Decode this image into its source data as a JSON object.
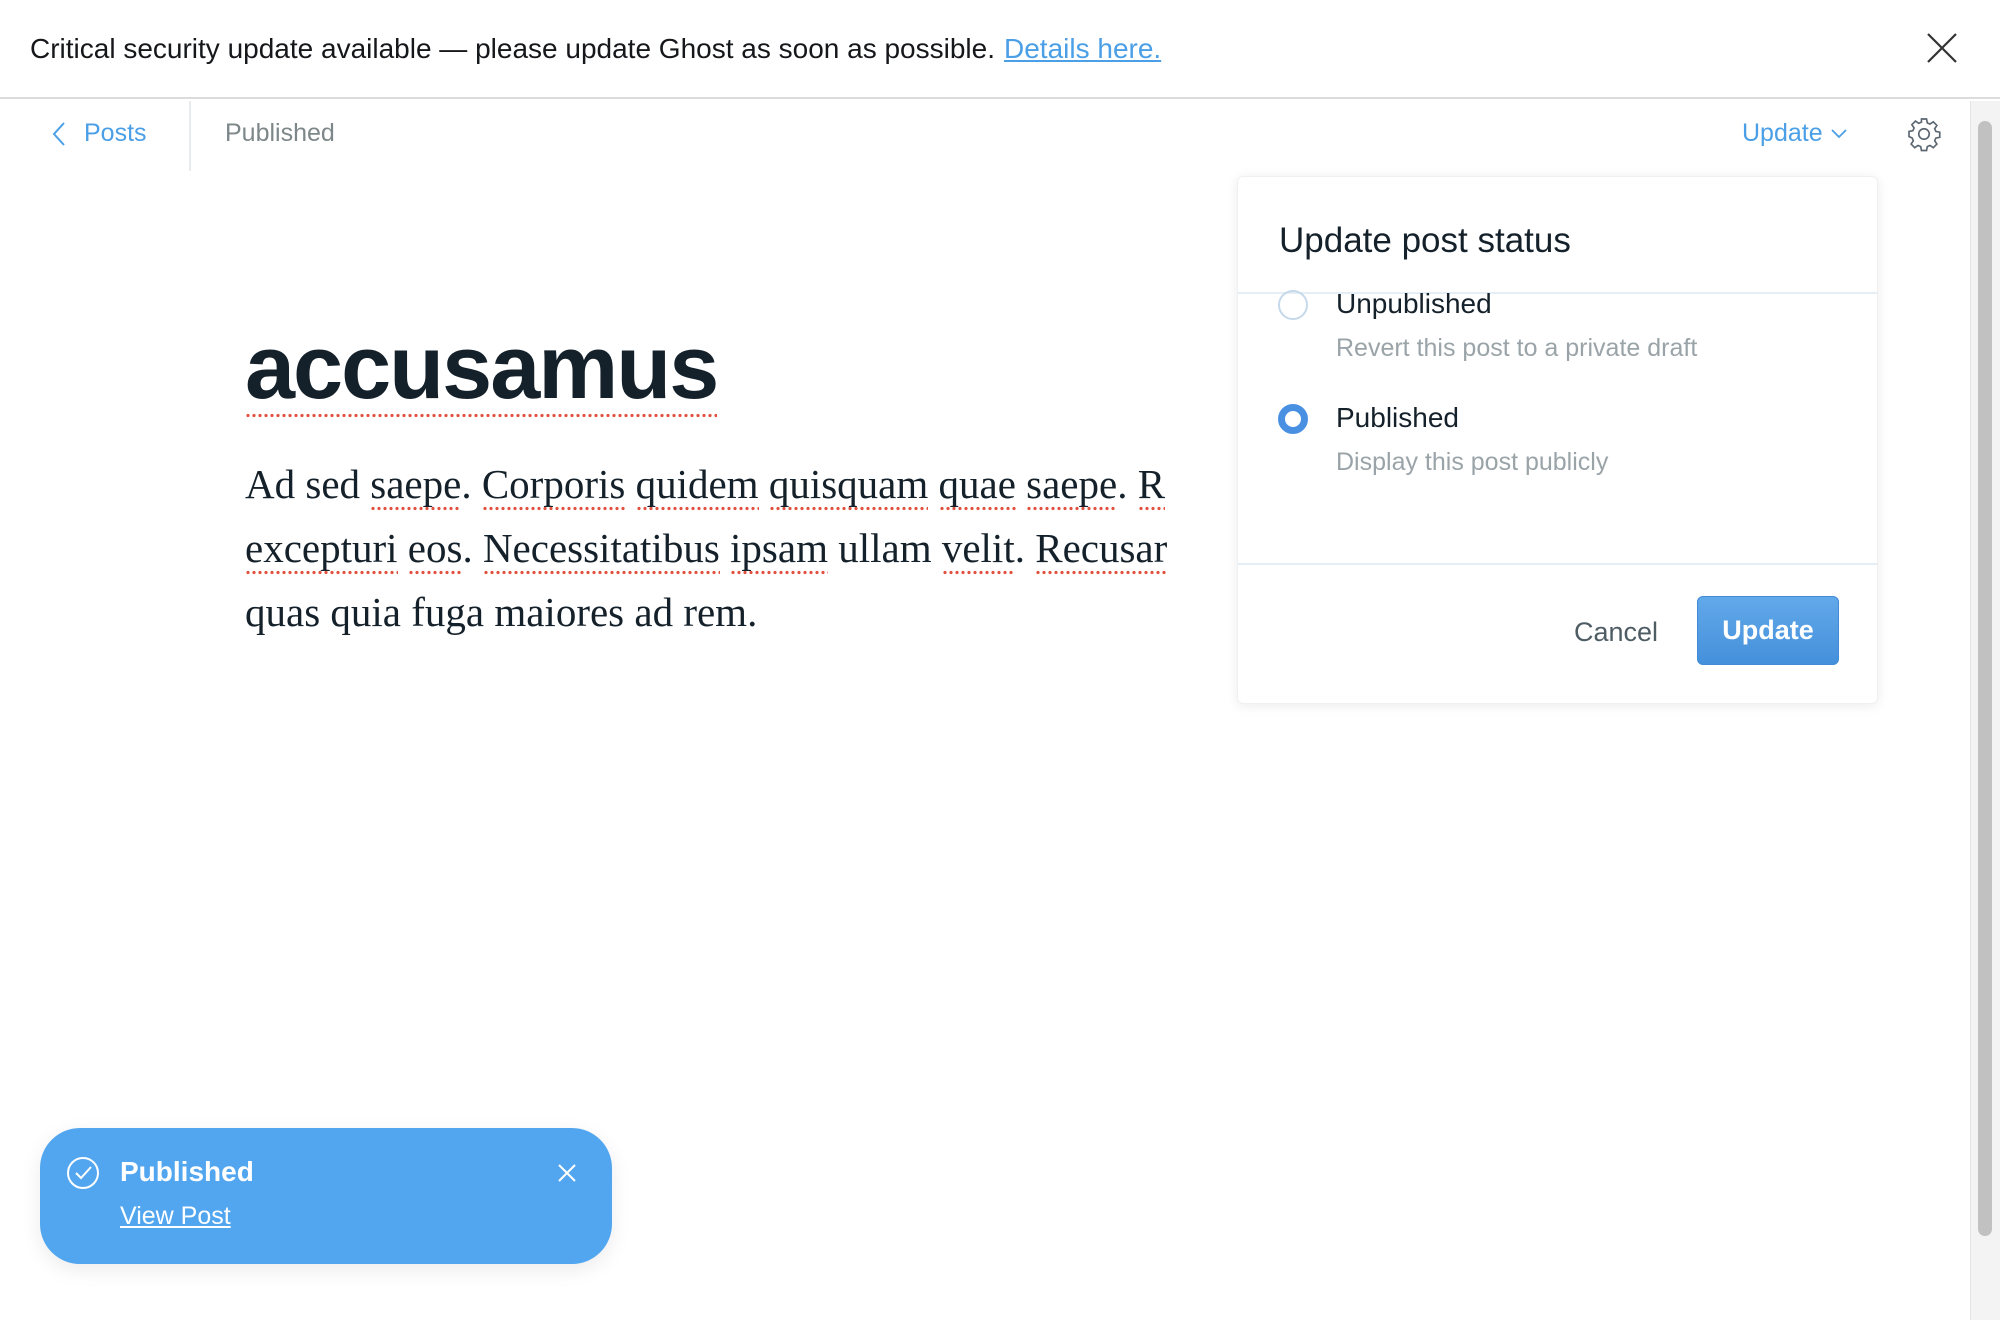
{
  "banner": {
    "message": "Critical security update available — please update Ghost as soon as possible.",
    "link": "Details here.",
    "close_icon": "close-icon"
  },
  "nav": {
    "back_label": "Posts",
    "status": "Published",
    "update_label": "Update",
    "settings_icon": "gear-icon"
  },
  "post": {
    "title": "accusamus",
    "lines": [
      [
        {
          "t": "Ad sed "
        },
        {
          "t": "saepe",
          "s": 1
        },
        {
          "t": ". "
        },
        {
          "t": "Corporis",
          "s": 1
        },
        {
          "t": " "
        },
        {
          "t": "quidem",
          "s": 1
        },
        {
          "t": " "
        },
        {
          "t": "quisquam",
          "s": 1
        },
        {
          "t": " "
        },
        {
          "t": "quae",
          "s": 1
        },
        {
          "t": " "
        },
        {
          "t": "saepe",
          "s": 1
        },
        {
          "t": ". "
        },
        {
          "t": "R",
          "s": 1
        }
      ],
      [
        {
          "t": "excepturi",
          "s": 1
        },
        {
          "t": " "
        },
        {
          "t": "eos",
          "s": 1
        },
        {
          "t": ". "
        },
        {
          "t": "Necessitatibus",
          "s": 1
        },
        {
          "t": " "
        },
        {
          "t": "ipsam",
          "s": 1
        },
        {
          "t": " ullam "
        },
        {
          "t": "velit",
          "s": 1
        },
        {
          "t": ". "
        },
        {
          "t": "Recusar",
          "s": 1
        }
      ],
      [
        {
          "t": "quas quia fuga maiores ad rem."
        }
      ]
    ]
  },
  "popup": {
    "title": "Update post status",
    "options": [
      {
        "label": "Unpublished",
        "description": "Revert this post to a private draft",
        "selected": false
      },
      {
        "label": "Published",
        "description": "Display this post publicly",
        "selected": true
      }
    ],
    "cancel": "Cancel",
    "update": "Update"
  },
  "toast": {
    "title": "Published",
    "link": "View Post",
    "color": "#52a6ef"
  },
  "colors": {
    "accent": "#4a9fe6",
    "primary_button": "#4a90e2"
  }
}
